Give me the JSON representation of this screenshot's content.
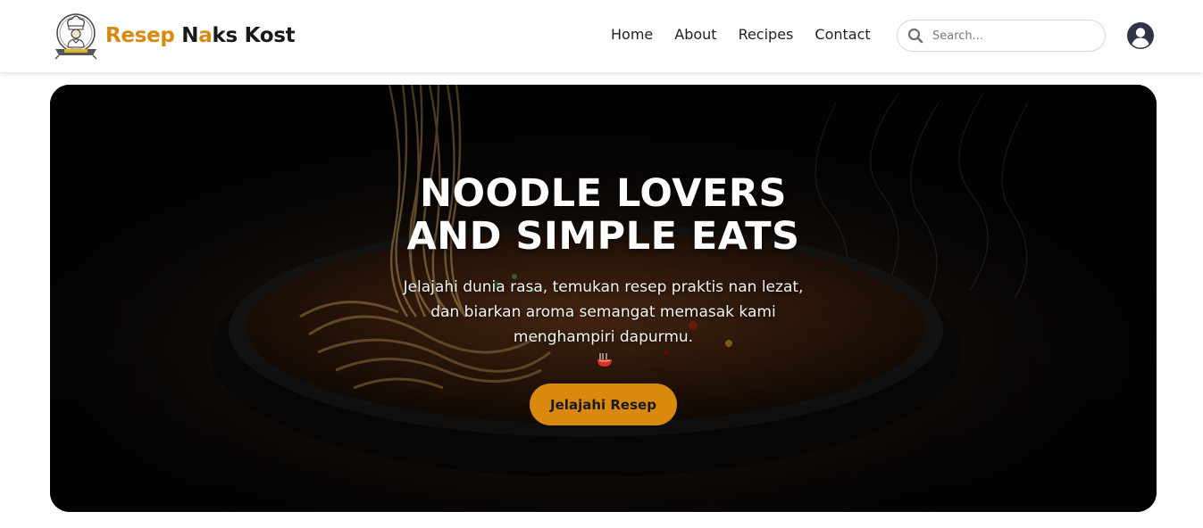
{
  "brand": {
    "name_part1": "Resep",
    "name_part2_n": "N",
    "name_part2_a": "a",
    "name_part2_rest": "ks Kost",
    "logo_icon": "chef-logo-icon",
    "accent_color": "#d9890d"
  },
  "nav": {
    "items": [
      {
        "label": "Home"
      },
      {
        "label": "About"
      },
      {
        "label": "Recipes"
      },
      {
        "label": "Contact"
      }
    ]
  },
  "search": {
    "placeholder": "Search...",
    "value": "",
    "icon": "search-icon"
  },
  "user": {
    "icon": "user-circle-icon"
  },
  "hero": {
    "title_line1": "NOODLE LOVERS",
    "title_line2": "AND SIMPLE EATS",
    "subtitle_line1": "Jelajahi dunia rasa, temukan resep praktis nan lezat,",
    "subtitle_line2": "dan biarkan aroma semangat memasak kami",
    "subtitle_line3": "menghampiri dapurmu.",
    "subtitle_emoji": "noodle-bowl-icon",
    "cta_label": "Jelajahi Resep",
    "cta_color": "#d9890d"
  }
}
